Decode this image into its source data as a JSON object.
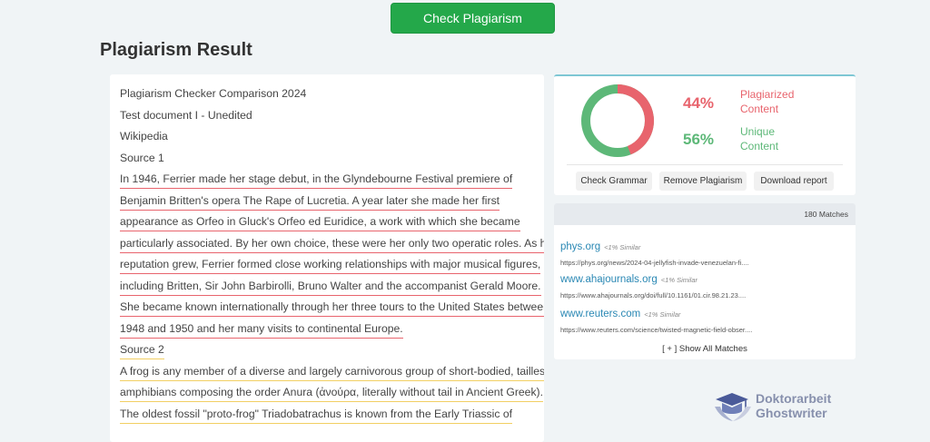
{
  "header": {
    "check_button": "Check Plagiarism",
    "title": "Plagiarism Result"
  },
  "document": {
    "lines": [
      {
        "text": "Plagiarism Checker Comparison 2024",
        "style": "plain"
      },
      {
        "text": "Test document I - Unedited",
        "style": "plain"
      },
      {
        "text": "Wikipedia",
        "style": "plain"
      },
      {
        "text": "Source 1",
        "style": "plain"
      },
      {
        "text": "In 1946, Ferrier made her stage debut, in the Glyndebourne Festival premiere of",
        "style": "red"
      },
      {
        "text": "Benjamin Britten's opera The Rape of Lucretia. A year later she made her first",
        "style": "red"
      },
      {
        "text": "appearance as Orfeo in Gluck's Orfeo ed Euridice, a work with which she became",
        "style": "red"
      },
      {
        "text": "particularly associated. By her own choice, these were her only two operatic roles. As her",
        "style": "red"
      },
      {
        "text": "reputation grew, Ferrier formed close working relationships with major musical figures,",
        "style": "red"
      },
      {
        "text": "including Britten, Sir John Barbirolli, Bruno Walter and the accompanist Gerald Moore.",
        "style": "red"
      },
      {
        "text": "She became known internationally through her three tours to the United States between",
        "style": "red"
      },
      {
        "text": "1948 and 1950 and her many visits to continental Europe.",
        "style": "red"
      },
      {
        "text": "Source 2",
        "style": "yellow"
      },
      {
        "text": "A frog is any member of a diverse and largely carnivorous group of short-bodied, tailless",
        "style": "yellow"
      },
      {
        "text": "amphibians composing the order Anura (ἀνούρα, literally without tail in Ancient Greek).",
        "style": "yellow"
      },
      {
        "text": "The oldest fossil \"proto-frog\" Triadobatrachus is known from the Early Triassic of",
        "style": "yellow"
      }
    ]
  },
  "result": {
    "plagiarized_percent": 44,
    "plagiarized_value": "44%",
    "plagiarized_label": "Plagiarized Content",
    "unique_value": "56%",
    "unique_label": "Unique Content",
    "colors": {
      "plagiarized": "#e8646d",
      "unique": "#5db878"
    },
    "actions": [
      "Check Grammar",
      "Remove Plagiarism",
      "Download report"
    ]
  },
  "matches": {
    "count_label": "180 Matches",
    "items": [
      {
        "title": "phys.org",
        "similarity": "<1% Similar",
        "url": "https://phys.org/news/2024-04-jellyfish-invade-venezuelan-fi...."
      },
      {
        "title": "www.ahajournals.org",
        "similarity": "<1% Similar",
        "url": "https://www.ahajournals.org/doi/full/10.1161/01.cir.98.21.23...."
      },
      {
        "title": "www.reuters.com",
        "similarity": "<1% Similar",
        "url": "https://www.reuters.com/science/twisted-magnetic-field-obser...."
      }
    ],
    "show_all": "[ + ] Show All Matches"
  },
  "logo": {
    "line1": "Doktorarbeit",
    "line2": "Ghostwriter"
  }
}
